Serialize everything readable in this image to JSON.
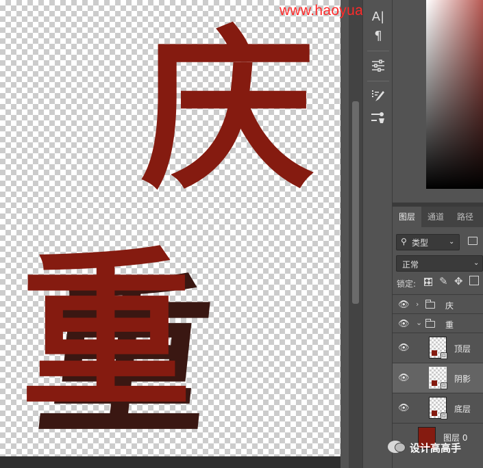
{
  "watermark_url": "www.haoyuanshe ji.com",
  "canvas": {
    "glyph_top": "庆",
    "glyph_bottom": "重"
  },
  "toolstrip": {
    "tools": [
      "A|",
      "¶",
      "≡",
      "⁝",
      "⇌"
    ]
  },
  "layers_panel": {
    "tabs": [
      "图层",
      "通道",
      "路径"
    ],
    "active_tab": "图层",
    "filter_label": "类型",
    "blend_mode": "正常",
    "lock_label": "锁定:",
    "layers": [
      {
        "name": "庆",
        "kind": "group",
        "expanded": false
      },
      {
        "name": "重",
        "kind": "group",
        "expanded": true
      },
      {
        "name": "顶层",
        "kind": "smart"
      },
      {
        "name": "阴影",
        "kind": "smart",
        "selected": true
      },
      {
        "name": "底层",
        "kind": "smart"
      },
      {
        "name": "图层 0",
        "kind": "fill"
      }
    ]
  },
  "footer_watermark": "设计高高手",
  "colors": {
    "glyph_red": "#851b10",
    "shadow": "#3a1712",
    "watermark": "#ff2a2a"
  }
}
